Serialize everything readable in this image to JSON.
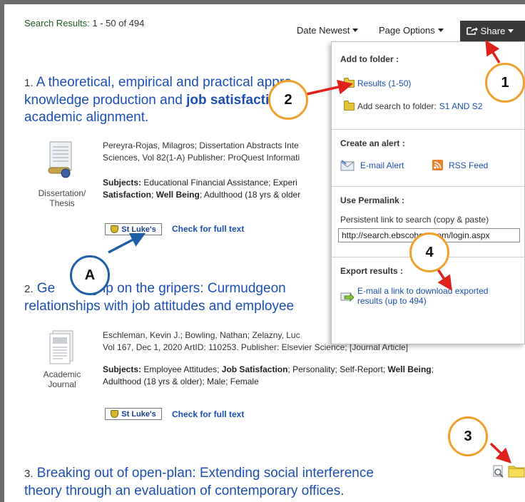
{
  "results_header": {
    "label": "Search Results:",
    "range": "1 - 50 of 494"
  },
  "toolbar": {
    "sort_label": "Date Newest",
    "page_options_label": "Page Options",
    "share_label": "Share"
  },
  "share_panel": {
    "add_to_folder_heading": "Add to folder :",
    "results_folder_link": "Results (1-50)",
    "add_search_text": "Add search to folder:",
    "add_search_link": "S1 AND S2",
    "create_alert_heading": "Create an alert :",
    "email_alert_label": "E-mail Alert",
    "rss_feed_label": "RSS Feed",
    "permalink_heading": "Use Permalink :",
    "permalink_desc": "Persistent link to search (copy & paste)",
    "permalink_value": "http://search.ebscohost.com/login.aspx",
    "export_heading": "Export results :",
    "export_link_line1": "E-mail a link to download exported",
    "export_link_line2": "results (up to 494)"
  },
  "results": [
    {
      "index": "1.",
      "title_line1": "A theoretical, empirical and practical appro",
      "title_line2a": "knowledge production and ",
      "title_line2b": "job satisfaction",
      "title_line2c": ":",
      "title_line3": "academic alignment.",
      "meta_line1": "Pereyra-Rojas, Milagros; Dissertation Abstracts Inte",
      "meta_line2": "Sciences, Vol 82(1-A) Publisher: ProQuest Informati",
      "subjects_label": "Subjects:",
      "subjects_line1": "Educational Financial Assistance; Experi",
      "subjects_line2a": "Satisfaction",
      "subjects_line2b": "; ",
      "subjects_line2c": "Well Being",
      "subjects_line2d": "; Adulthood (18 yrs & older",
      "doc_type_line1": "Dissertation/",
      "doc_type_line2": "Thesis",
      "library_badge": "St Luke's",
      "full_text_link": "Check for full text"
    },
    {
      "index": "2.",
      "title_line1a": "Ge",
      "title_line1b": "grip on the gripers: Curmudgeon",
      "title_line2": "relationships with job attitudes and employee",
      "meta_line1": "Eschleman, Kevin J.; Bowling, Nathan; Zelazny, Luc",
      "meta_line2": "Vol 167, Dec 1, 2020 ArtID: 110253. Publisher: Elsevier Science; [Journal Article]",
      "subjects_label": "Subjects:",
      "subjects_line1a": "Employee Attitudes; ",
      "subjects_line1b": "Job Satisfaction",
      "subjects_line1c": "; Personality; Self-Report; ",
      "subjects_line1d": "Well Being",
      "subjects_line1e": ";",
      "subjects_line2": "Adulthood (18 yrs & older); Male; Female",
      "doc_type_line1": "Academic",
      "doc_type_line2": "Journal",
      "library_badge": "St Luke's",
      "full_text_link": "Check for full text"
    },
    {
      "index": "3.",
      "title_line1": "Breaking out of open-plan: Extending social interference",
      "title_line2": "theory through an evaluation of contemporary offices."
    }
  ],
  "callouts": {
    "c1": "1",
    "c2": "2",
    "c3": "3",
    "c4": "4",
    "cA": "A"
  },
  "colors": {
    "link": "#1b4fb3",
    "callout_orange": "#f0a02a",
    "callout_blue": "#1f5fa8",
    "arrow_red": "#e0201b",
    "share_button": "#3a3a3a"
  }
}
